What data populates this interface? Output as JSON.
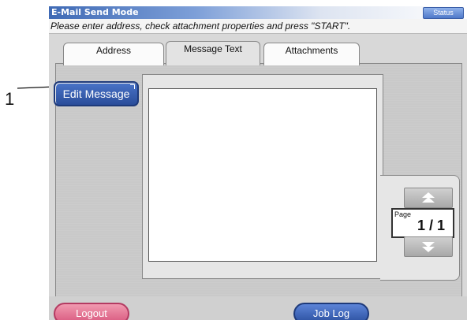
{
  "callout": {
    "number": "1"
  },
  "window": {
    "title": "E-Mail Send Mode",
    "status_label": "Status",
    "instruction": "Please enter address, check attachment properties and press \"START\"."
  },
  "tabs": [
    {
      "label": "Address"
    },
    {
      "label": "Message Text",
      "active": true
    },
    {
      "label": "Attachments"
    }
  ],
  "panel": {
    "edit_message_label": "Edit Message",
    "page_label": "Page",
    "page_value": "1 / 1",
    "scroll_up_icon": "double-chevron-up-icon",
    "scroll_down_icon": "double-chevron-down-icon"
  },
  "footer": {
    "logout_label": "Logout",
    "job_log_label": "Job Log"
  },
  "colors": {
    "title_blue": "#3f6ab5",
    "button_blue": "#2a4d9a",
    "logout_pink": "#d9587e"
  }
}
